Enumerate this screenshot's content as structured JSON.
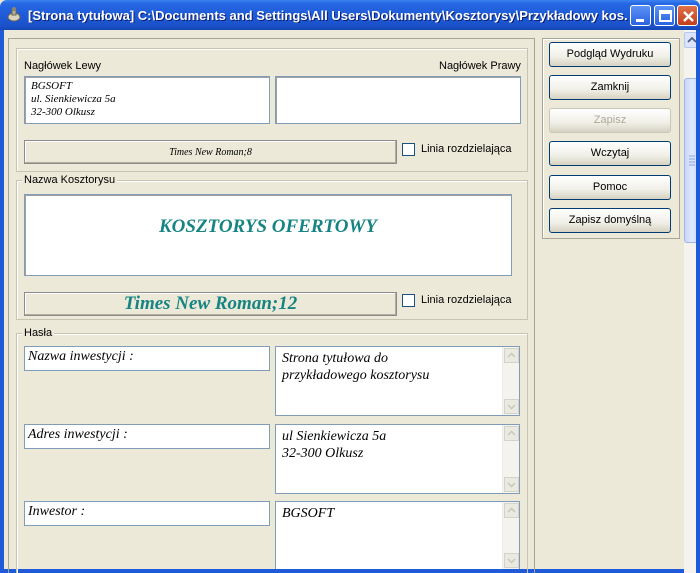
{
  "window": {
    "title": "[Strona tytułowa] C:\\Documents and Settings\\All Users\\Dokumenty\\Kosztorysy\\Przykładowy kos..."
  },
  "header": {
    "left_label": "Nagłówek Lewy",
    "right_label": "Nagłówek Prawy",
    "left_text": "BGSOFT\nul. Sienkiewicza 5a\n32-300 Olkusz",
    "right_text": "",
    "font_button": "Times New Roman;8",
    "divider_label": "Linia rozdzielająca"
  },
  "name_group": {
    "label": "Nazwa Kosztorysu",
    "title_text": "KOSZTORYS OFERTOWY",
    "font_button": "Times New Roman;12",
    "divider_label": "Linia rozdzielająca",
    "text_color": "#168483"
  },
  "keywords_group": {
    "label": "Hasła",
    "rows": [
      {
        "key": "Nazwa inwestycji :",
        "value": "Strona tytułowa do\nprzykładowego kosztorysu"
      },
      {
        "key": "Adres inwestycji :",
        "value": "ul Sienkiewicza 5a\n32-300 Olkusz"
      },
      {
        "key": "Inwestor :",
        "value": "BGSOFT"
      }
    ]
  },
  "side_buttons": {
    "preview": "Podgląd Wydruku",
    "close": "Zamknij",
    "save": "Zapisz",
    "load": "Wczytaj",
    "help": "Pomoc",
    "save_default": "Zapisz domyślną"
  },
  "icons": {
    "app": "app-icon",
    "minimize": "minimize-icon",
    "maximize": "maximize-icon",
    "close": "close-icon"
  },
  "colors": {
    "titlebar": "#1f5bd8",
    "accent_text": "#168483"
  }
}
